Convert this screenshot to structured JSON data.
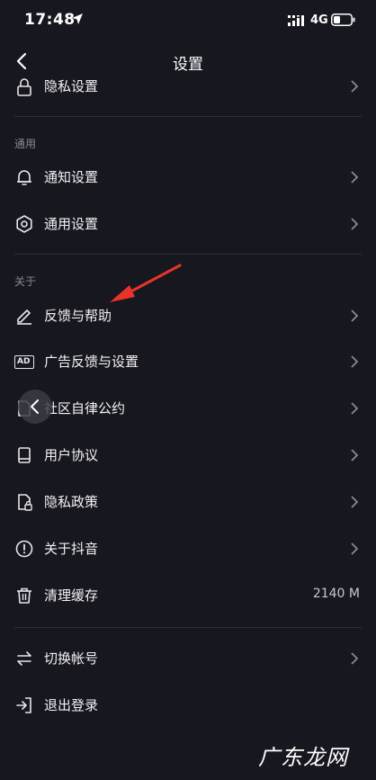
{
  "status_bar": {
    "time": "17:48",
    "network": "4G"
  },
  "nav": {
    "title": "设置"
  },
  "rows": {
    "privacy_settings": "隐私设置",
    "notification_settings": "通知设置",
    "general_settings": "通用设置",
    "feedback_help": "反馈与帮助",
    "ad_feedback": "广告反馈与设置",
    "community_rules": "社区自律公约",
    "user_agreement": "用户协议",
    "privacy_policy": "隐私政策",
    "about": "关于抖音",
    "clear_cache": "清理缓存",
    "cache_size": "2140 M",
    "switch_account": "切换帐号",
    "logout": "退出登录"
  },
  "sections": {
    "general": "通用",
    "about": "关于"
  },
  "icons": {
    "ad_badge_text": "AD"
  },
  "watermark": "广东龙网",
  "colors": {
    "background": "#17171f",
    "accent_arrow": "#e8332b",
    "text": "#f2f2f4",
    "muted": "#8a8a96"
  }
}
